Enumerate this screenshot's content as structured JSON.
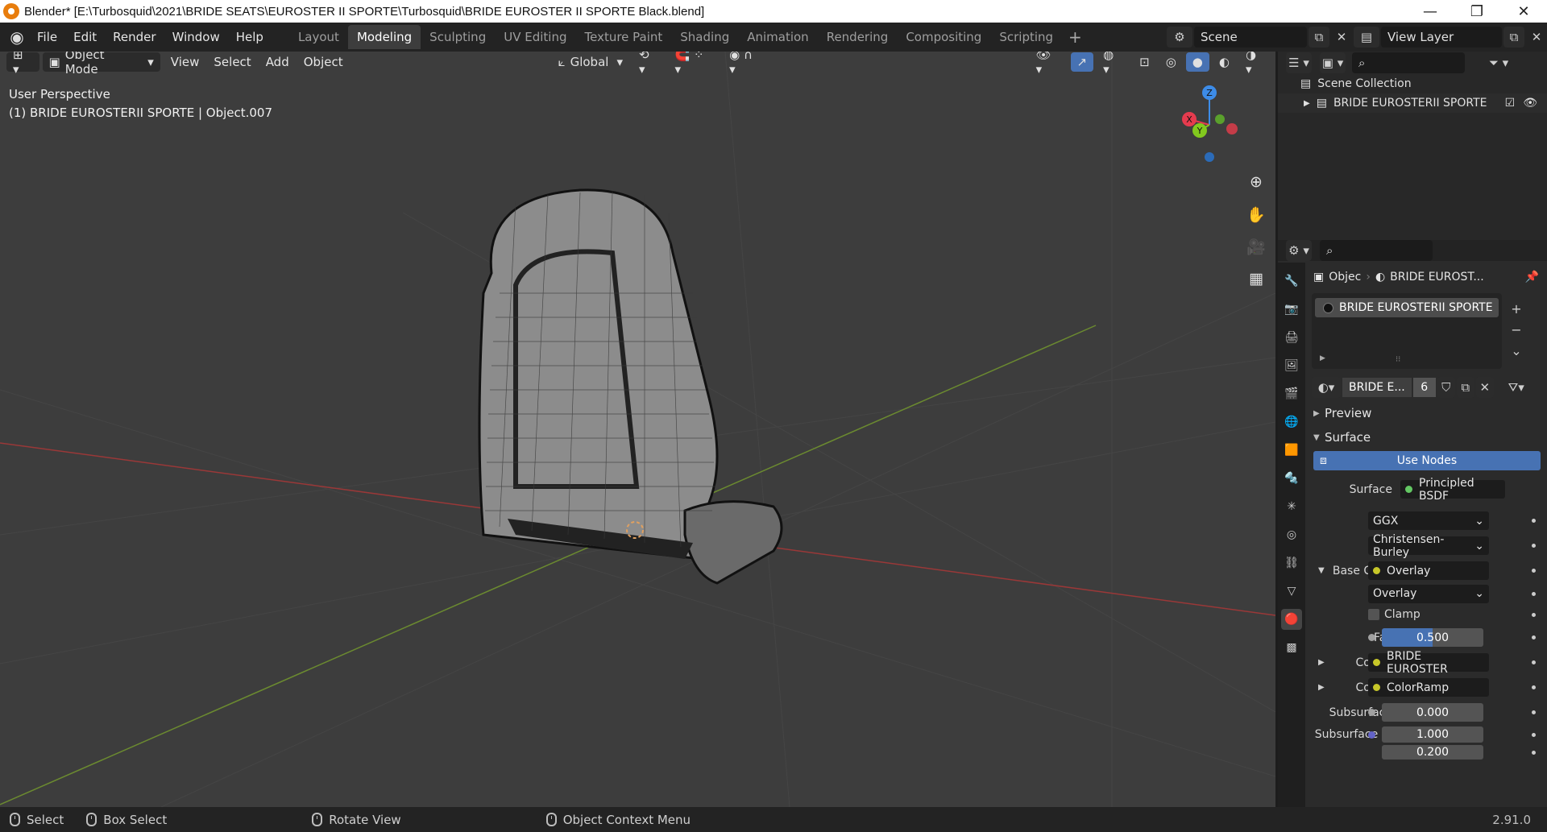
{
  "window": {
    "title": "Blender* [E:\\Turbosquid\\2021\\BRIDE SEATS\\EUROSTER II SPORTE\\Turbosquid\\BRIDE EUROSTER II SPORTE Black.blend]",
    "controls": {
      "minimize": "—",
      "maximize": "❐",
      "close": "✕"
    }
  },
  "menu": {
    "items": [
      "File",
      "Edit",
      "Render",
      "Window",
      "Help"
    ]
  },
  "workspaces": {
    "tabs": [
      "Layout",
      "Modeling",
      "Sculpting",
      "UV Editing",
      "Texture Paint",
      "Shading",
      "Animation",
      "Rendering",
      "Compositing",
      "Scripting"
    ],
    "active": "Modeling",
    "add": "+"
  },
  "scene": {
    "name": "Scene",
    "view_layer": "View Layer"
  },
  "viewport_header": {
    "mode": "Object Mode",
    "menus": [
      "View",
      "Select",
      "Add",
      "Object"
    ],
    "transform_orientation": "Global"
  },
  "viewport": {
    "perspective": "User Perspective",
    "object_info": "(1) BRIDE EUROSTERII SPORTE  | Object.007",
    "gizmo": {
      "x": "X",
      "y": "Y",
      "z": "Z"
    }
  },
  "outliner": {
    "root": "Scene Collection",
    "items": [
      {
        "name": "BRIDE EUROSTERII SPORTE"
      }
    ]
  },
  "properties": {
    "breadcrumb": {
      "object": "Objec",
      "material": "BRIDE  EUROST..."
    },
    "material_slot": "BRIDE  EUROSTERII SPORTE",
    "material": {
      "name": "BRIDE  E...",
      "users": "6"
    },
    "panels": {
      "preview": "Preview",
      "surface": "Surface"
    },
    "use_nodes": "Use Nodes",
    "rows": {
      "surface": {
        "label": "Surface",
        "value": "Principled BSDF"
      },
      "distribution": "GGX",
      "subsurface_method": "Christensen-Burley",
      "base_color": {
        "label": "Base Col...",
        "value": "Overlay"
      },
      "blend_mode": "Overlay",
      "clamp": "Clamp",
      "fac": {
        "label": "Fac",
        "value": "0.500"
      },
      "color1": {
        "label": "Color1",
        "value": "BRIDE  EUROSTER"
      },
      "color2": {
        "label": "Color2",
        "value": "ColorRamp"
      },
      "subsurface": {
        "label": "Subsurface",
        "value": "0.000"
      },
      "subsurface_radius": {
        "label": "Subsurface ...",
        "value1": "1.000",
        "value2": "0.200"
      }
    }
  },
  "statusbar": {
    "select": "Select",
    "box_select": "Box Select",
    "rotate_view": "Rotate View",
    "context_menu": "Object Context Menu",
    "version": "2.91.0"
  },
  "colors": {
    "accent": "#4772b3",
    "x_axis": "#e53b4e",
    "y_axis": "#82c91e",
    "z_axis": "#3d8ce8"
  }
}
